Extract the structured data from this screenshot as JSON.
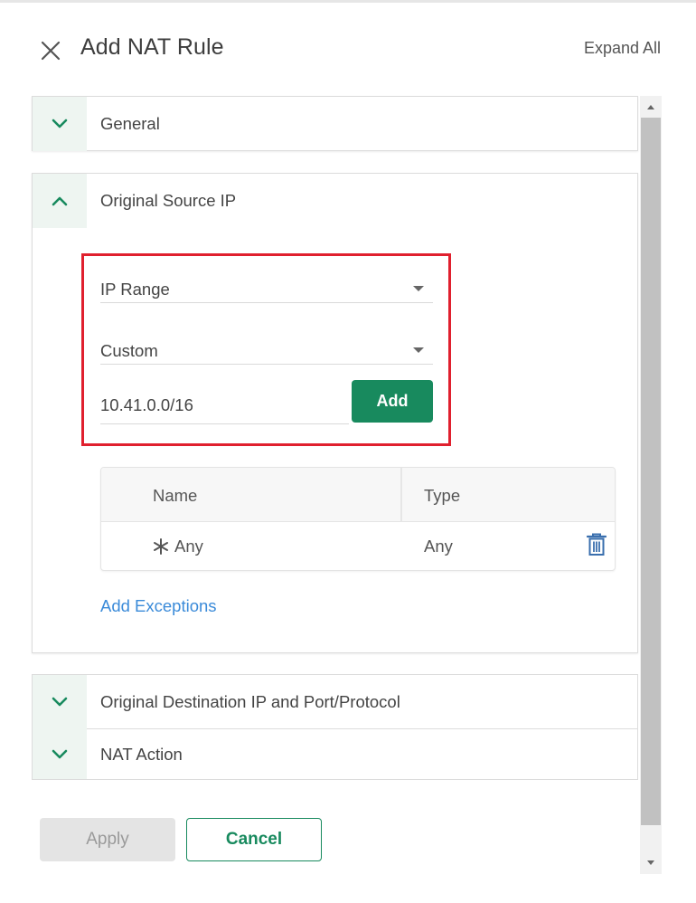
{
  "header": {
    "title": "Add NAT Rule",
    "expand_all": "Expand All",
    "close_icon": "close-icon"
  },
  "sections": {
    "general": {
      "title": "General",
      "expanded": false
    },
    "original_source": {
      "title": "Original Source IP",
      "expanded": true,
      "ip_type_select": "IP Range",
      "source_select": "Custom",
      "ip_input_value": "10.41.0.0/16",
      "add_label": "Add",
      "table": {
        "columns": [
          "Name",
          "Type"
        ],
        "rows": [
          {
            "name": "Any",
            "type": "Any"
          }
        ]
      },
      "add_exceptions": "Add Exceptions"
    },
    "original_destination": {
      "title": "Original Destination IP and Port/Protocol",
      "expanded": false
    },
    "nat_action": {
      "title": "NAT Action",
      "expanded": false
    }
  },
  "footer": {
    "apply": "Apply",
    "cancel": "Cancel"
  },
  "colors": {
    "accent": "#188a5e",
    "link": "#3b8bd9",
    "highlight": "#e0202e",
    "chevron_bg": "#eef5f1"
  }
}
